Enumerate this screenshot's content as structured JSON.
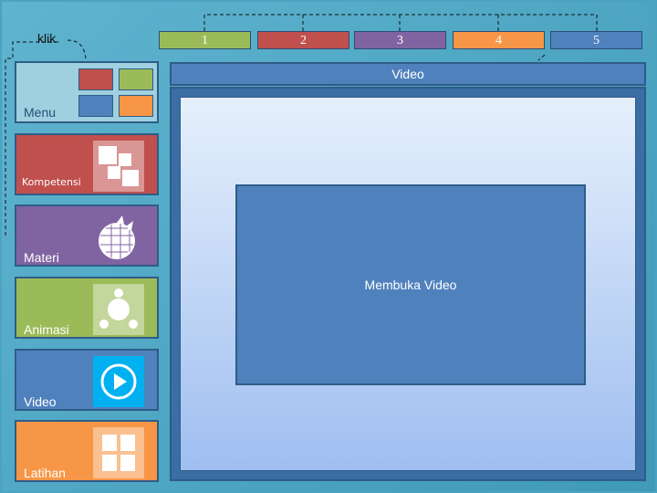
{
  "klik_label": "klik",
  "number_tabs": [
    {
      "label": "1",
      "color": "#9bbb59"
    },
    {
      "label": "2",
      "color": "#c0504d"
    },
    {
      "label": "3",
      "color": "#8064a2"
    },
    {
      "label": "4",
      "color": "#f79646"
    },
    {
      "label": "5",
      "color": "#4f81bd"
    }
  ],
  "menu": {
    "label": "Menu",
    "mini_colors": [
      "#c0504d",
      "#9bbb59",
      "#4f81bd",
      "#f79646"
    ]
  },
  "tiles": [
    {
      "label": "Kompetensi",
      "color": "#c0504d",
      "icon": "puzzle-squares-icon"
    },
    {
      "label": "Materi",
      "color": "#8064a2",
      "icon": "globe-wiki-icon"
    },
    {
      "label": "Animasi",
      "color": "#9bbb59",
      "icon": "molecule-icon"
    },
    {
      "label": "Video",
      "color": "#4f81bd",
      "icon": "play-icon"
    },
    {
      "label": "Latihan",
      "color": "#f79646",
      "icon": "grid-icon"
    }
  ],
  "header_title": "Video",
  "video_box_label": "Membuka Video"
}
